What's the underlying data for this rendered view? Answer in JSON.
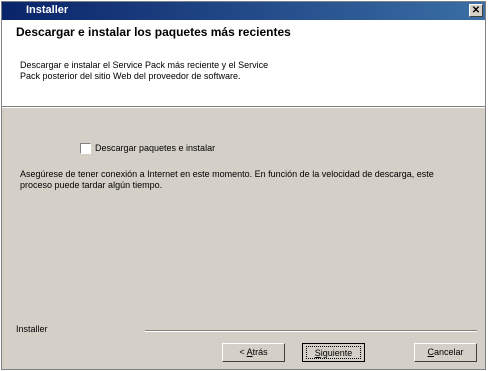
{
  "window": {
    "title": "Installer"
  },
  "header": {
    "heading": "Descargar e instalar los paquetes más recientes",
    "subtext": "Descargar e instalar el Service Pack más reciente y el Service Pack posterior del sitio Web del proveedor de software."
  },
  "body": {
    "checkbox_label": "Descargar paquetes e instalar",
    "checkbox_checked": false,
    "info": "Asegúrese de tener conexión a Internet en este momento. En función de la velocidad de descarga, este proceso puede tardar algún tiempo."
  },
  "footer": {
    "label": "Installer",
    "back_prefix": "< ",
    "back_key": "A",
    "back_rest": "trás",
    "next_key": "S",
    "next_rest": "iguiente",
    "cancel_key": "C",
    "cancel_rest": "ancelar"
  }
}
